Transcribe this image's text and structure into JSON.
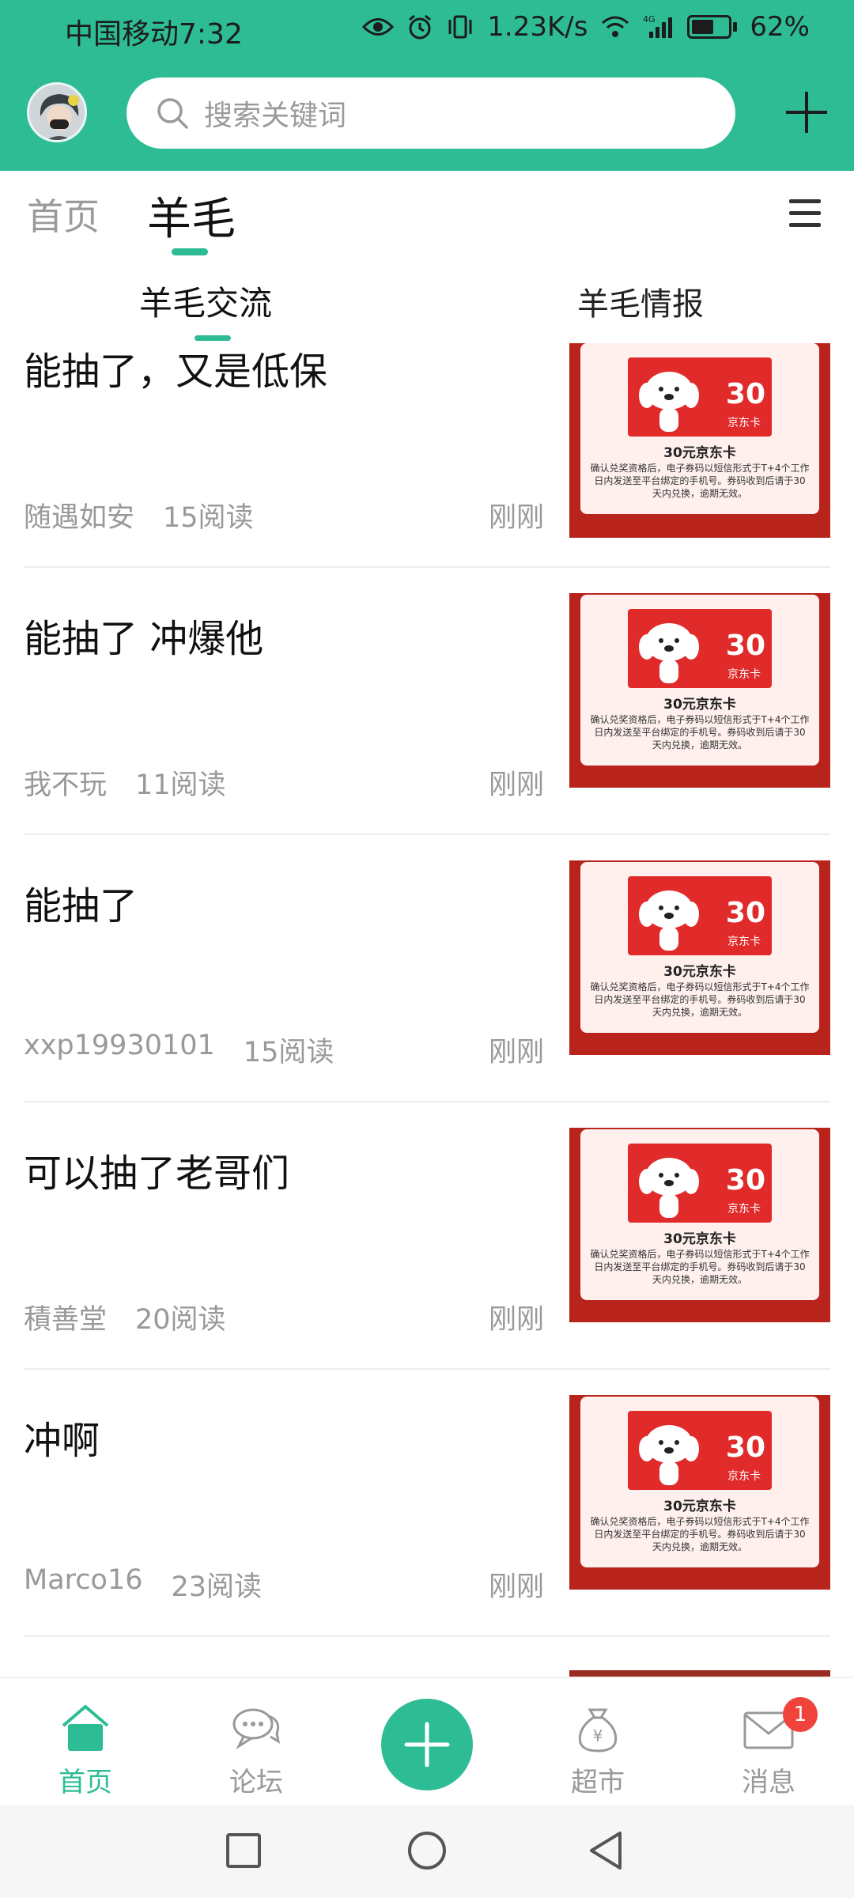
{
  "status_bar": {
    "carrier_time": "中国移动7:32",
    "net_speed": "1.23K/s",
    "network_type": "4G",
    "battery": "62%",
    "battery_level": 0.62,
    "icons": [
      "eye-icon",
      "alarm-icon",
      "vibrate-icon",
      "wifi-icon",
      "signal-icon",
      "battery-icon"
    ]
  },
  "header": {
    "search_placeholder": "搜索关键词",
    "accent_color": "#2ebc95"
  },
  "top_tabs": [
    {
      "label": "首页",
      "active": false
    },
    {
      "label": "羊毛",
      "active": true
    }
  ],
  "sub_tabs": [
    {
      "label": "羊毛交流",
      "active": true
    },
    {
      "label": "羊毛情报",
      "active": false
    }
  ],
  "posts": [
    {
      "title": "能抽了，又是低保",
      "author": "随遇如安",
      "reads": "15阅读",
      "time": "刚刚"
    },
    {
      "title": "能抽了 冲爆他",
      "author": "我不玩",
      "reads": "11阅读",
      "time": "刚刚"
    },
    {
      "title": "能抽了",
      "author": "xxp19930101",
      "reads": "15阅读",
      "time": "刚刚"
    },
    {
      "title": "可以抽了老哥们",
      "author": "積善堂",
      "reads": "20阅读",
      "time": "刚刚"
    },
    {
      "title": "冲啊",
      "author": "Marco16",
      "reads": "23阅读",
      "time": "刚刚"
    }
  ],
  "thumbnail_card": {
    "amount": "30",
    "card_label": "京东卡",
    "title": "30元京东卡",
    "desc": "确认兑奖资格后，电子券码以短信形式于T+4个工作日内发送至平台绑定的手机号。券码收到后请于30天内兑换，逾期无效。"
  },
  "bottom_nav": [
    {
      "label": "首页",
      "icon": "home-icon",
      "active": true
    },
    {
      "label": "论坛",
      "icon": "chat-bubbles-icon",
      "active": false
    },
    {
      "label": "",
      "icon": "plus-icon",
      "active": false
    },
    {
      "label": "超市",
      "icon": "money-bag-icon",
      "active": false
    },
    {
      "label": "消息",
      "icon": "envelope-icon",
      "active": false,
      "badge": "1"
    }
  ],
  "system_nav": [
    "square-icon",
    "circle-icon",
    "back-triangle-icon"
  ]
}
